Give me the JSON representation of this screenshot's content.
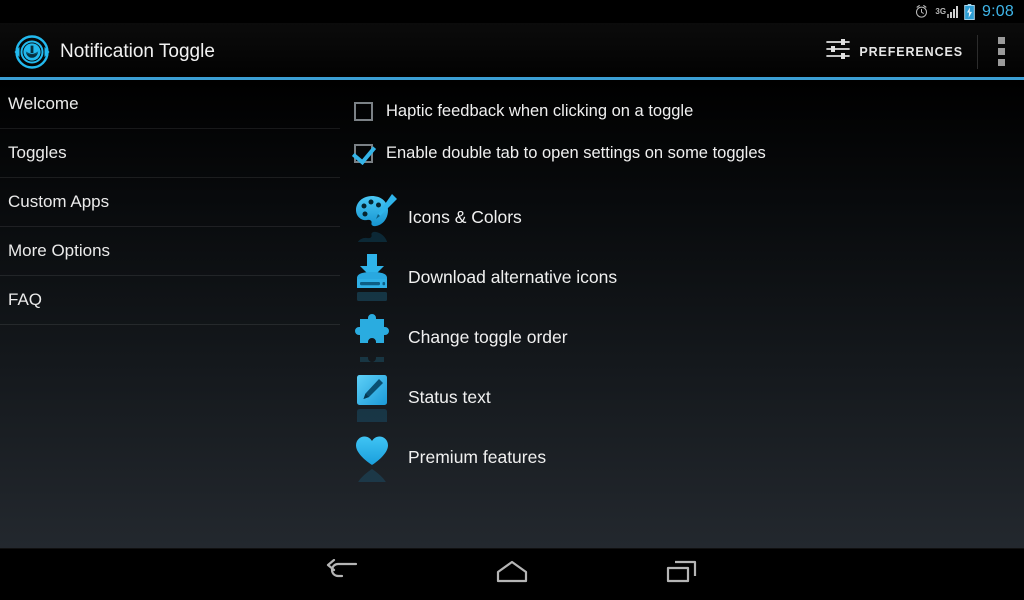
{
  "status_bar": {
    "alarm_icon": "alarm-clock-icon",
    "network_label": "3G",
    "signal_icon": "signal-bars-icon",
    "battery_icon": "battery-charging-icon",
    "clock": "9:08",
    "clock_color": "#3fb5e8"
  },
  "action_bar": {
    "logo_icon": "app-logo-icon",
    "title": "Notification Toggle",
    "preferences_icon": "sliders-icon",
    "preferences_label": "PREFERENCES",
    "overflow_icon": "overflow-menu-icon",
    "accent_color": "#3b9fd4"
  },
  "sidebar": {
    "items": [
      {
        "label": "Welcome"
      },
      {
        "label": "Toggles"
      },
      {
        "label": "Custom Apps"
      },
      {
        "label": "More Options"
      },
      {
        "label": "FAQ"
      }
    ]
  },
  "main": {
    "checkboxes": [
      {
        "label": "Haptic feedback when clicking on a toggle",
        "checked": false
      },
      {
        "label": "Enable double tab to open settings on some toggles",
        "checked": true
      }
    ],
    "options": [
      {
        "label": "Icons & Colors",
        "icon": "palette-icon"
      },
      {
        "label": "Download alternative icons",
        "icon": "download-icon"
      },
      {
        "label": "Change toggle order",
        "icon": "puzzle-piece-icon"
      },
      {
        "label": "Status text",
        "icon": "edit-pencil-icon"
      },
      {
        "label": "Premium features",
        "icon": "heart-icon"
      }
    ],
    "icon_color": "#29ade4"
  },
  "navbar": {
    "back_icon": "back-arrow-icon",
    "home_icon": "home-icon",
    "recents_icon": "recent-apps-icon"
  }
}
